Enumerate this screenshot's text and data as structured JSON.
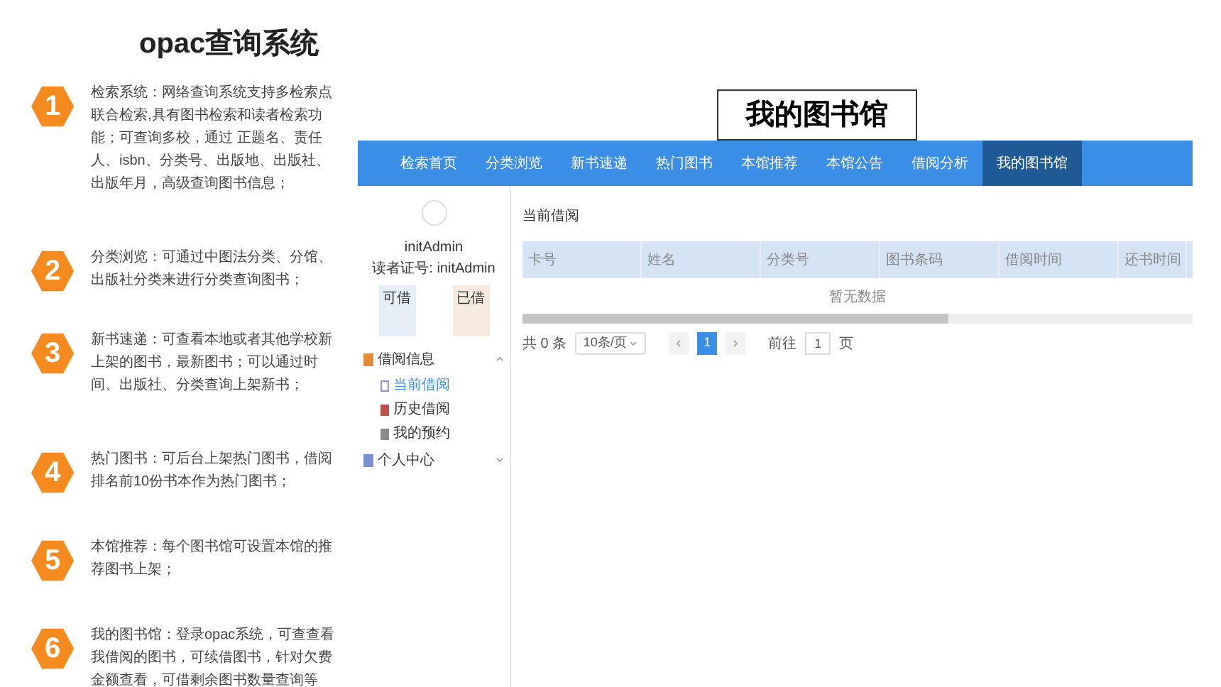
{
  "title": "opac查询系统",
  "features": [
    {
      "number": "1",
      "text": "检索系统：网络查询系统支持多检索点联合检索,具有图书检索和读者检索功能；可查询多校，通过 正题名、责任人、isbn、分类号、出版地、出版社、出版年月，高级查询图书信息；"
    },
    {
      "number": "2",
      "text": "分类浏览：可通过中图法分类、分馆、出版社分类来进行分类查询图书；"
    },
    {
      "number": "3",
      "text": "新书速递：可查看本地或者其他学校新上架的图书，最新图书；可以通过时间、出版社、分类查询上架新书；"
    },
    {
      "number": "4",
      "text": "热门图书：可后台上架热门图书，借阅排名前10份书本作为热门图书；"
    },
    {
      "number": "5",
      "text": "本馆推荐：每个图书馆可设置本馆的推荐图书上架；"
    },
    {
      "number": "6",
      "text": "我的图书馆：登录opac系统，可查查看我借阅的图书，可续借图书，针对欠费金额查看，可借剩余图书数量查询等"
    }
  ],
  "app": {
    "heading": "我的图书馆",
    "nav": [
      {
        "label": "检索首页",
        "selected": false
      },
      {
        "label": "分类浏览",
        "selected": false
      },
      {
        "label": "新书速递",
        "selected": false
      },
      {
        "label": "热门图书",
        "selected": false
      },
      {
        "label": "本馆推荐",
        "selected": false
      },
      {
        "label": "本馆公告",
        "selected": false
      },
      {
        "label": "借阅分析",
        "selected": false
      },
      {
        "label": "我的图书馆",
        "selected": true
      }
    ],
    "user": {
      "name": "initAdmin",
      "card": "读者证号: initAdmin",
      "can_borrow": "可借",
      "borrowed": "已借"
    },
    "menu": [
      {
        "label": "借阅信息",
        "expanded": true,
        "children": [
          {
            "label": "当前借阅",
            "selected": true
          },
          {
            "label": "历史借阅",
            "selected": false
          },
          {
            "label": "我的预约",
            "selected": false
          }
        ]
      },
      {
        "label": "个人中心",
        "expanded": false
      }
    ],
    "section_title": "当前借阅",
    "table": {
      "columns": [
        "卡号",
        "姓名",
        "分类号",
        "图书条码",
        "借阅时间",
        "还书时间"
      ],
      "empty_text": "暂无数据"
    },
    "pagination": {
      "total": "共 0 条",
      "page_size": "10条/页",
      "pages": [
        {
          "label": "1",
          "selected": true
        }
      ],
      "goto_label": "前往",
      "goto_value": "1",
      "goto_suffix": "页"
    }
  }
}
